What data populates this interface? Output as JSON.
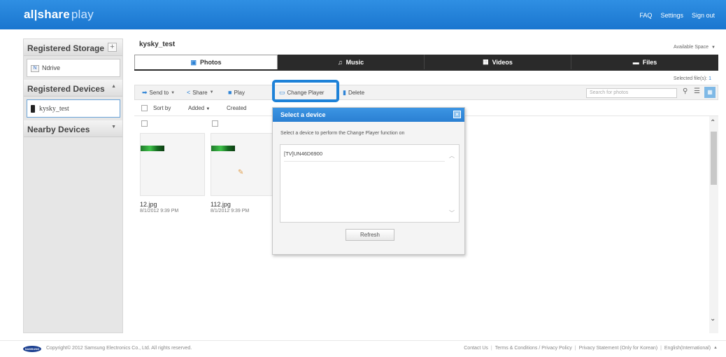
{
  "header": {
    "logo_main": "al|share",
    "logo_sub": "play",
    "links": [
      "FAQ",
      "Settings",
      "Sign out"
    ]
  },
  "sidebar": {
    "storage_title": "Registered Storage",
    "storage_add": "+",
    "storage_item": "Ndrive",
    "storage_item_icon": "N",
    "devices_title": "Registered Devices",
    "devices_item": "kysky_test",
    "nearby_title": "Nearby Devices"
  },
  "main": {
    "title": "kysky_test",
    "available_space": "Available Space",
    "selected_files_label": "Selected file(s):",
    "selected_files_count": "1",
    "tabs": [
      {
        "label": "Photos",
        "icon": "photo-icon"
      },
      {
        "label": "Music",
        "icon": "music-note-icon"
      },
      {
        "label": "Videos",
        "icon": "film-icon"
      },
      {
        "label": "Files",
        "icon": "folder-icon"
      }
    ],
    "toolbar": {
      "send_to": "Send to",
      "share": "Share",
      "play": "Play",
      "change_player": "Change Player",
      "delete": "Delete",
      "search_placeholder": "Search for photos"
    },
    "sortbar": {
      "sort_by": "Sort by",
      "added": "Added",
      "created": "Created"
    },
    "files": [
      {
        "name": "12.jpg",
        "date": "8/1/2012 9:39 PM"
      },
      {
        "name": "112.jpg",
        "date": "8/1/2012 9:39 PM"
      }
    ]
  },
  "dialog": {
    "title": "Select a device",
    "close": "×",
    "message": "Select a device to perform the Change Player function on",
    "devices": [
      "[TV]UN46D6900"
    ],
    "refresh_label": "Refresh"
  },
  "footer": {
    "brand": "SAMSUNG",
    "copyright": "Copyright© 2012 Samsung Electronics Co., Ltd. All rights reserved.",
    "links": [
      "Contact Us",
      "Terms & Conditions / Privacy Policy",
      "Privacy Statement (Only for Korean)",
      "English(International)"
    ]
  },
  "colors": {
    "accent": "#1e82d8",
    "header_bg": "#2a85dc",
    "tab_bg": "#2a2a2a"
  }
}
